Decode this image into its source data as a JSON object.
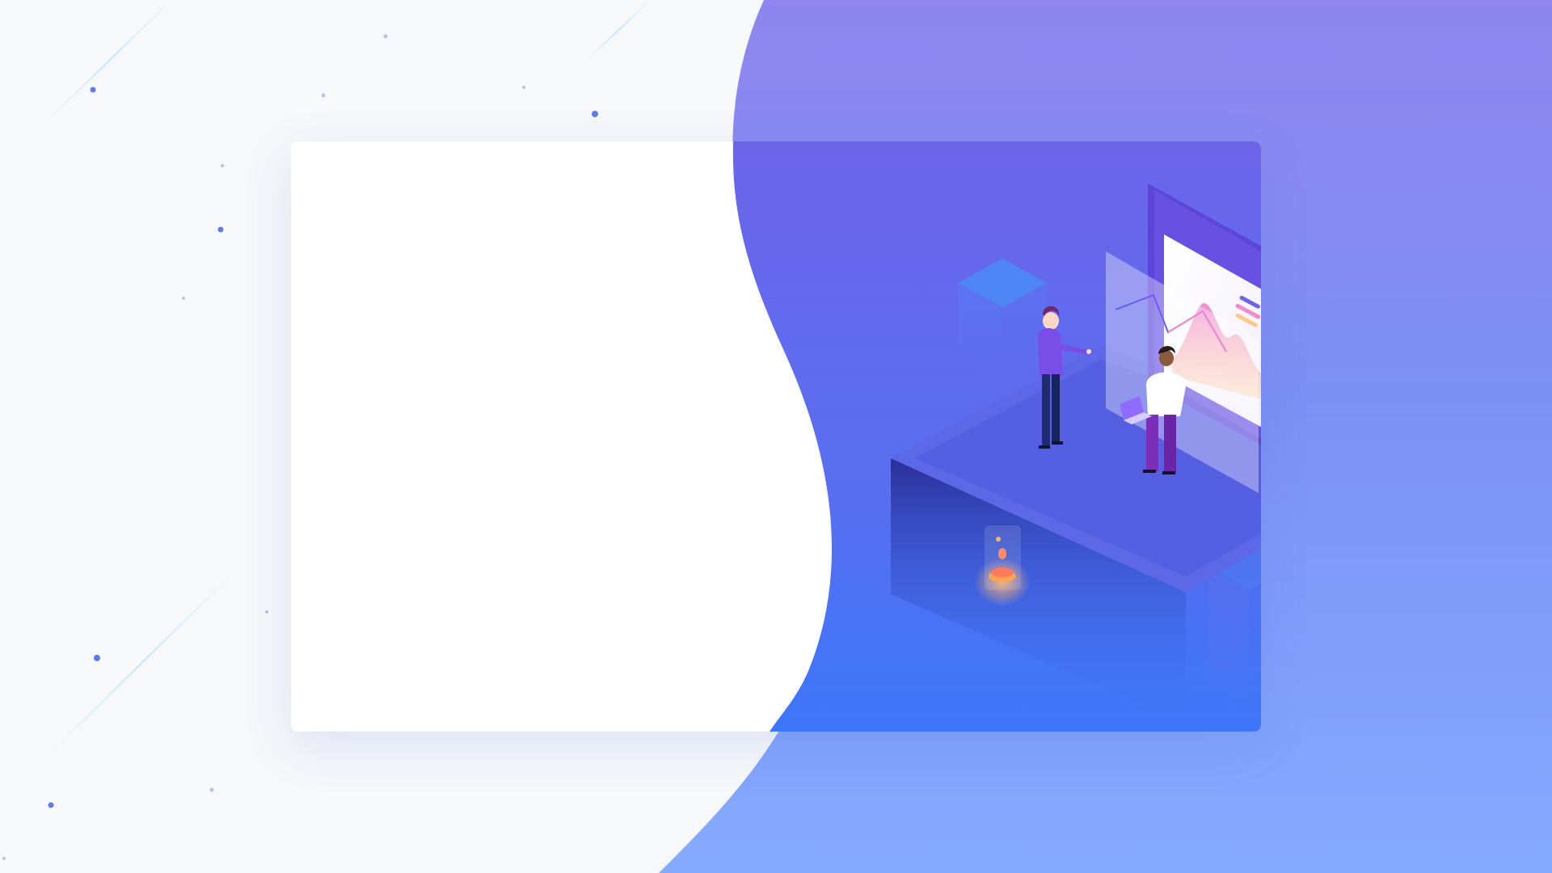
{
  "page": {
    "background_color": "#f7f8fa",
    "accent_top_color": "#8f86ef",
    "accent_bottom_color": "#84abff",
    "card_color": "#ffffff",
    "card_panel_top_color": "#6c65ea",
    "card_panel_bottom_color": "#3d76fa"
  },
  "illustration": {
    "subject": "isometric-data-analytics-scene",
    "icons": [
      "analytics-screen-icon",
      "line-chart-icon",
      "person-icon",
      "laptop-icon",
      "coin-icon",
      "building-icon"
    ]
  }
}
